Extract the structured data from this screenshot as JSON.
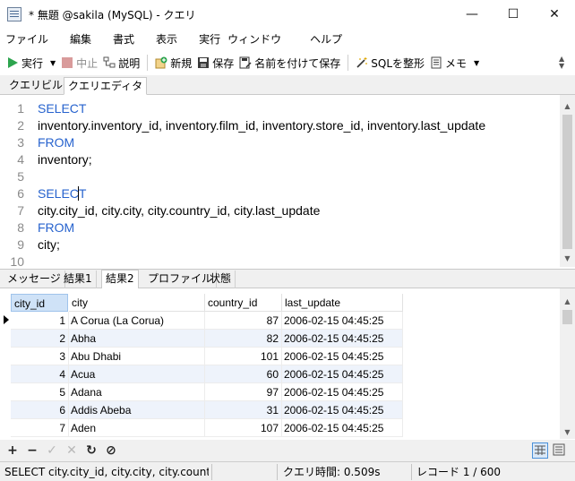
{
  "window": {
    "title": "* 無題 @sakila (MySQL) - クエリ",
    "minimize": "—",
    "maximize": "☐",
    "close": "✕"
  },
  "menu": [
    "ファイル",
    "編集",
    "書式",
    "表示",
    "実行",
    "ウィンドウ",
    "ヘルプ"
  ],
  "toolbar": {
    "run": "実行",
    "stop": "中止",
    "explain": "説明",
    "new": "新規",
    "save": "保存",
    "save_as": "名前を付けて保存",
    "format_sql": "SQLを整形",
    "memo": "メモ"
  },
  "editor_tabs": {
    "builder": "クエリビルダ",
    "editor": "クエリエディタ"
  },
  "editor": {
    "line_numbers": [
      "1",
      "2",
      "3",
      "4",
      "5",
      "6",
      "7",
      "8",
      "9",
      "10"
    ],
    "lines": [
      {
        "text": "SELECT",
        "kw": true
      },
      {
        "text": "inventory.inventory_id, inventory.film_id, inventory.store_id, inventory.last_update",
        "kw": false
      },
      {
        "text": "FROM",
        "kw": true
      },
      {
        "text": "inventory;",
        "kw": false
      },
      {
        "text": "",
        "kw": false
      },
      {
        "text": "SELECT",
        "kw": true
      },
      {
        "text": "city.city_id, city.city, city.country_id, city.last_update",
        "kw": false
      },
      {
        "text": "FROM",
        "kw": true
      },
      {
        "text": "city;",
        "kw": false
      },
      {
        "text": "",
        "kw": false
      }
    ]
  },
  "result_tabs": [
    "メッセージ",
    "結果1",
    "結果2",
    "プロファイル",
    "状態"
  ],
  "grid": {
    "columns": [
      "city_id",
      "city",
      "country_id",
      "last_update"
    ],
    "rows": [
      [
        "1",
        "A Corua (La Corua)",
        "87",
        "2006-02-15 04:45:25"
      ],
      [
        "2",
        "Abha",
        "82",
        "2006-02-15 04:45:25"
      ],
      [
        "3",
        "Abu Dhabi",
        "101",
        "2006-02-15 04:45:25"
      ],
      [
        "4",
        "Acua",
        "60",
        "2006-02-15 04:45:25"
      ],
      [
        "5",
        "Adana",
        "97",
        "2006-02-15 04:45:25"
      ],
      [
        "6",
        "Addis Abeba",
        "31",
        "2006-02-15 04:45:25"
      ],
      [
        "7",
        "Aden",
        "107",
        "2006-02-15 04:45:25"
      ]
    ]
  },
  "grid_toolbar": {
    "add": "+",
    "delete": "−",
    "apply": "✓",
    "discard": "✕",
    "refresh": "↻",
    "stop": "⊘"
  },
  "status": {
    "sql": "SELECT city.city_id, city.city, city.country_i",
    "query_time": "クエリ時間: 0.509s",
    "record": "レコード 1 / 600"
  },
  "colors": {
    "keyword": "#2763ce",
    "accent_green": "#2da44e",
    "header_selected": "#cfe2f7"
  }
}
